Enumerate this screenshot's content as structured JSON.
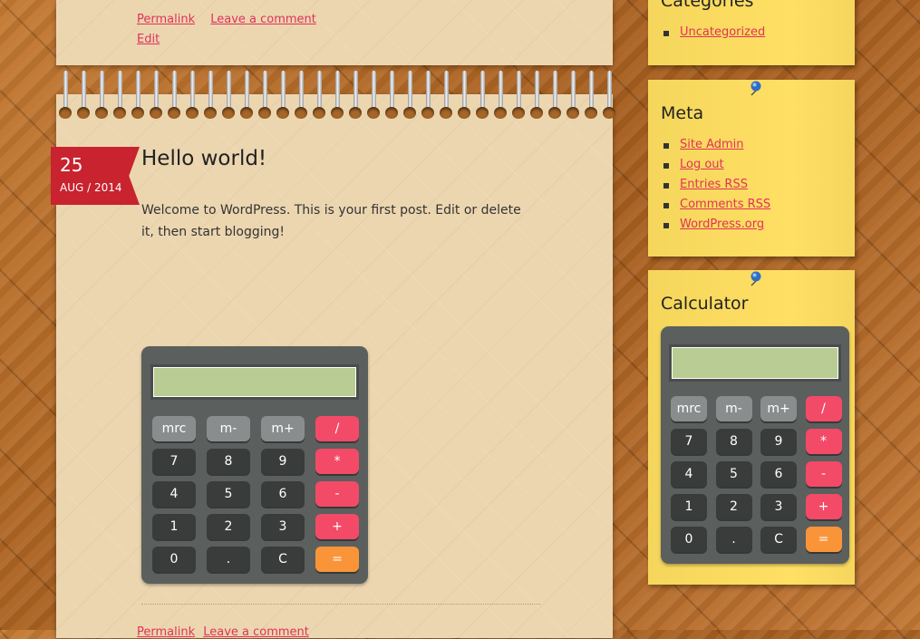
{
  "post_top_meta": {
    "permalink": "Permalink",
    "leave_comment": "Leave a comment",
    "edit": "Edit"
  },
  "post": {
    "date_day": "25",
    "date_month_year": "AUG / 2014",
    "title": "Hello world!",
    "body": "Welcome to WordPress. This is your first post. Edit or delete it, then start blogging!"
  },
  "post_footer": {
    "permalink": "Permalink",
    "leave_comment": "Leave a comment"
  },
  "calculator_keys": [
    {
      "label": "mrc",
      "type": "mem"
    },
    {
      "label": "m-",
      "type": "mem"
    },
    {
      "label": "m+",
      "type": "mem"
    },
    {
      "label": "/",
      "type": "op"
    },
    {
      "label": "7",
      "type": "num"
    },
    {
      "label": "8",
      "type": "num"
    },
    {
      "label": "9",
      "type": "num"
    },
    {
      "label": "*",
      "type": "op"
    },
    {
      "label": "4",
      "type": "num"
    },
    {
      "label": "5",
      "type": "num"
    },
    {
      "label": "6",
      "type": "num"
    },
    {
      "label": "-",
      "type": "op"
    },
    {
      "label": "1",
      "type": "num"
    },
    {
      "label": "2",
      "type": "num"
    },
    {
      "label": "3",
      "type": "num"
    },
    {
      "label": "+",
      "type": "op"
    },
    {
      "label": "0",
      "type": "num"
    },
    {
      "label": ".",
      "type": "num"
    },
    {
      "label": "C",
      "type": "num"
    },
    {
      "label": "=",
      "type": "eq"
    }
  ],
  "sidebar": {
    "categories": {
      "title": "Categories",
      "items": [
        "Uncategorized"
      ]
    },
    "meta": {
      "title": "Meta",
      "items": [
        "Site Admin",
        "Log out",
        "Entries RSS",
        "Comments RSS",
        "WordPress.org"
      ]
    },
    "calculator": {
      "title": "Calculator"
    }
  },
  "colors": {
    "link": "#e0325a",
    "ribbon": "#c8232f",
    "note": "#ffe064",
    "paper": "#ecd6b0",
    "calc_body": "#5b5f5e",
    "calc_display": "#b8cc93",
    "key_memory": "#8a8d8d",
    "key_number": "#3a3c3c",
    "key_operator": "#f34a67",
    "key_equals": "#f99538"
  }
}
